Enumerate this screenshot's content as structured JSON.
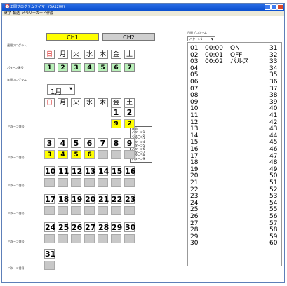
{
  "window": {
    "title": "年間プログラムタイマー(SA1200)"
  },
  "menu": [
    "終了",
    "転送",
    "メモリーカード作成"
  ],
  "channels": {
    "ch1": "CH1",
    "ch2": "CH2"
  },
  "weekly": {
    "label": "週間プログラム",
    "pattern_label": "パターン番号",
    "days": [
      "日",
      "月",
      "火",
      "水",
      "木",
      "金",
      "土"
    ],
    "patterns": [
      "1",
      "2",
      "3",
      "4",
      "5",
      "6",
      "7"
    ]
  },
  "annual": {
    "label": "年間プログラム",
    "month": "1月",
    "days": [
      "日",
      "月",
      "火",
      "水",
      "木",
      "金",
      "土"
    ],
    "pattern_label": "パターン番号",
    "weeks": [
      [
        "",
        "",
        "",
        "",
        "",
        "1",
        "2"
      ],
      [
        "3",
        "4",
        "5",
        "6",
        "7",
        "8",
        "9"
      ],
      [
        "10",
        "11",
        "12",
        "13",
        "14",
        "15",
        "16"
      ],
      [
        "17",
        "18",
        "19",
        "20",
        "21",
        "22",
        "23"
      ],
      [
        "24",
        "25",
        "26",
        "27",
        "28",
        "29",
        "30"
      ],
      [
        "31"
      ]
    ],
    "patterns": [
      [
        "",
        "",
        "",
        "",
        "",
        "9",
        "2"
      ],
      [
        "3",
        "4",
        "5",
        "6",
        "",
        "",
        ""
      ],
      [
        "",
        "",
        "",
        "",
        "",
        "",
        ""
      ],
      [
        "",
        "",
        "",
        "",
        "",
        "",
        ""
      ],
      [
        "",
        "",
        "",
        "",
        "",
        "",
        ""
      ],
      [
        ""
      ]
    ]
  },
  "popup": {
    "items": [
      "無効",
      "パターン1",
      "パターン2",
      "パターン3",
      "パターン4",
      "パターン5",
      "パターン6",
      "パターン7",
      "パターン8",
      "パターン9"
    ]
  },
  "daily": {
    "label": "日間プログラム",
    "pattern_select": "パターン1",
    "rows_left": [
      "01",
      "02",
      "03",
      "04",
      "05",
      "06",
      "07",
      "08",
      "09",
      "10",
      "11",
      "12",
      "13",
      "14",
      "15",
      "16",
      "17",
      "18",
      "19",
      "20",
      "21",
      "22",
      "23",
      "24",
      "25",
      "26",
      "27",
      "28",
      "29",
      "30"
    ],
    "entries": [
      {
        "time": "00:00",
        "action": "ON"
      },
      {
        "time": "00:01",
        "action": "OFF"
      },
      {
        "time": "00:02",
        "action": "パルス"
      }
    ],
    "rows_right": [
      "31",
      "32",
      "33",
      "34",
      "35",
      "36",
      "37",
      "38",
      "39",
      "40",
      "41",
      "42",
      "43",
      "44",
      "45",
      "46",
      "47",
      "48",
      "49",
      "50",
      "51",
      "52",
      "53",
      "54",
      "55",
      "56",
      "57",
      "58",
      "59",
      "60"
    ]
  }
}
